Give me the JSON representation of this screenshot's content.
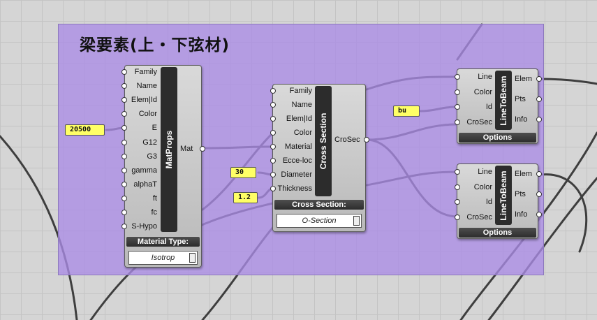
{
  "group_title": "梁要素(上・下弦材)",
  "matprops": {
    "name": "MatProps",
    "inputs": [
      "Family",
      "Name",
      "Elem|Id",
      "Color",
      "E",
      "G12",
      "G3",
      "gamma",
      "alphaT",
      "ft",
      "fc",
      "S-Hypo"
    ],
    "output": "Mat",
    "caption": "Material Type:",
    "dropdown_value": "Isotrop"
  },
  "cross_section": {
    "name": "Cross Section",
    "inputs": [
      "Family",
      "Name",
      "Elem|Id",
      "Color",
      "Material",
      "Ecce-loc",
      "Diameter",
      "Thickness"
    ],
    "output": "CroSec",
    "caption": "Cross Section:",
    "dropdown_value": "O-Section"
  },
  "line_to_beam_1": {
    "name": "LineToBeam",
    "inputs": [
      "Line",
      "Color",
      "Id",
      "CroSec"
    ],
    "outputs": [
      "Elem",
      "Pts",
      "Info"
    ],
    "options_label": "Options"
  },
  "line_to_beam_2": {
    "name": "LineToBeam",
    "inputs": [
      "Line",
      "Color",
      "Id",
      "CroSec"
    ],
    "outputs": [
      "Elem",
      "Pts",
      "Info"
    ],
    "options_label": "Options"
  },
  "panels": {
    "e_value": "20500",
    "diameter": "30",
    "thickness": "1.2",
    "id_value": "bu"
  },
  "colors": {
    "group_fill": "#aa8ce6",
    "canvas": "#d5d5d5",
    "wire": "#3e3e3e",
    "panel": "#ffff66"
  }
}
